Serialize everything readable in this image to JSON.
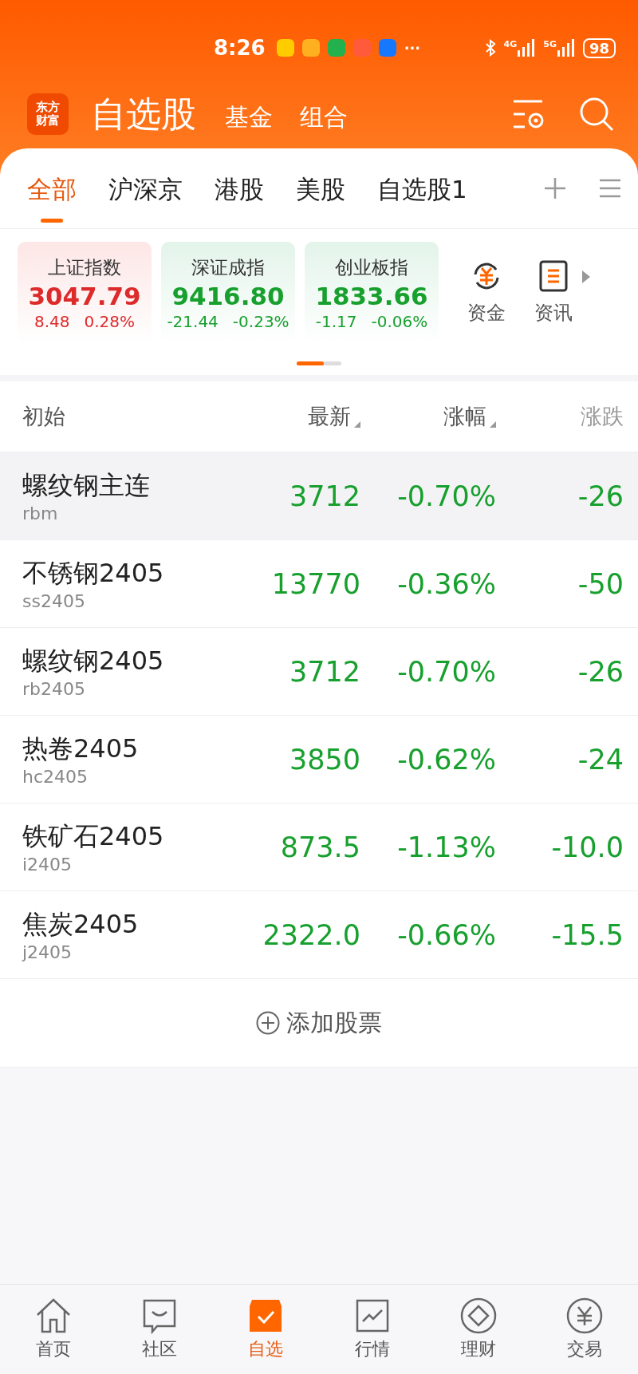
{
  "status_bar": {
    "time": "8:26",
    "notification_apps": [
      {
        "color": "#ffcc00"
      },
      {
        "color": "#ffb020"
      },
      {
        "color": "#22b14c"
      },
      {
        "color": "#ff5a3c"
      },
      {
        "color": "#1677ff"
      }
    ],
    "more": "···",
    "networks": [
      "4G",
      "5G"
    ],
    "battery": "98"
  },
  "header": {
    "logo": [
      "东方",
      "财富"
    ],
    "title": "自选股",
    "links": [
      "基金",
      "组合"
    ]
  },
  "tabs": [
    {
      "label": "全部",
      "selected": true
    },
    {
      "label": "沪深京",
      "selected": false
    },
    {
      "label": "港股",
      "selected": false
    },
    {
      "label": "美股",
      "selected": false
    },
    {
      "label": "自选股1",
      "selected": false
    }
  ],
  "indices": [
    {
      "name": "上证指数",
      "value": "3047.79",
      "change": "8.48",
      "percent": "0.28%",
      "rising": true
    },
    {
      "name": "深证成指",
      "value": "9416.80",
      "change": "-21.44",
      "percent": "-0.23%",
      "rising": false
    },
    {
      "name": "创业板指",
      "value": "1833.66",
      "change": "-1.17",
      "percent": "-0.06%",
      "rising": false
    }
  ],
  "shortcuts": [
    {
      "label": "资金",
      "kind": "fund"
    },
    {
      "label": "资讯",
      "kind": "news"
    }
  ],
  "table": {
    "columns": [
      {
        "label": "初始",
        "sortable": false
      },
      {
        "label": "最新",
        "sortable": true
      },
      {
        "label": "涨幅",
        "sortable": true
      },
      {
        "label": "涨跌",
        "sortable": false
      }
    ],
    "rows": [
      {
        "name": "螺纹钢主连",
        "code": "rbm",
        "price": "3712",
        "percent": "-0.70%",
        "change": "-26",
        "rising": false,
        "selected": true
      },
      {
        "name": "不锈钢2405",
        "code": "ss2405",
        "price": "13770",
        "percent": "-0.36%",
        "change": "-50",
        "rising": false,
        "selected": false
      },
      {
        "name": "螺纹钢2405",
        "code": "rb2405",
        "price": "3712",
        "percent": "-0.70%",
        "change": "-26",
        "rising": false,
        "selected": false
      },
      {
        "name": "热卷2405",
        "code": "hc2405",
        "price": "3850",
        "percent": "-0.62%",
        "change": "-24",
        "rising": false,
        "selected": false
      },
      {
        "name": "铁矿石2405",
        "code": "i2405",
        "price": "873.5",
        "percent": "-1.13%",
        "change": "-10.0",
        "rising": false,
        "selected": false
      },
      {
        "name": "焦炭2405",
        "code": "j2405",
        "price": "2322.0",
        "percent": "-0.66%",
        "change": "-15.5",
        "rising": false,
        "selected": false
      }
    ]
  },
  "add_button": "添加股票",
  "bottom_nav": [
    {
      "label": "首页",
      "kind": "home",
      "selected": false
    },
    {
      "label": "社区",
      "kind": "community",
      "selected": false
    },
    {
      "label": "自选",
      "kind": "watchlist",
      "selected": true
    },
    {
      "label": "行情",
      "kind": "market",
      "selected": false
    },
    {
      "label": "理财",
      "kind": "wealth",
      "selected": false
    },
    {
      "label": "交易",
      "kind": "trade",
      "selected": false
    }
  ]
}
